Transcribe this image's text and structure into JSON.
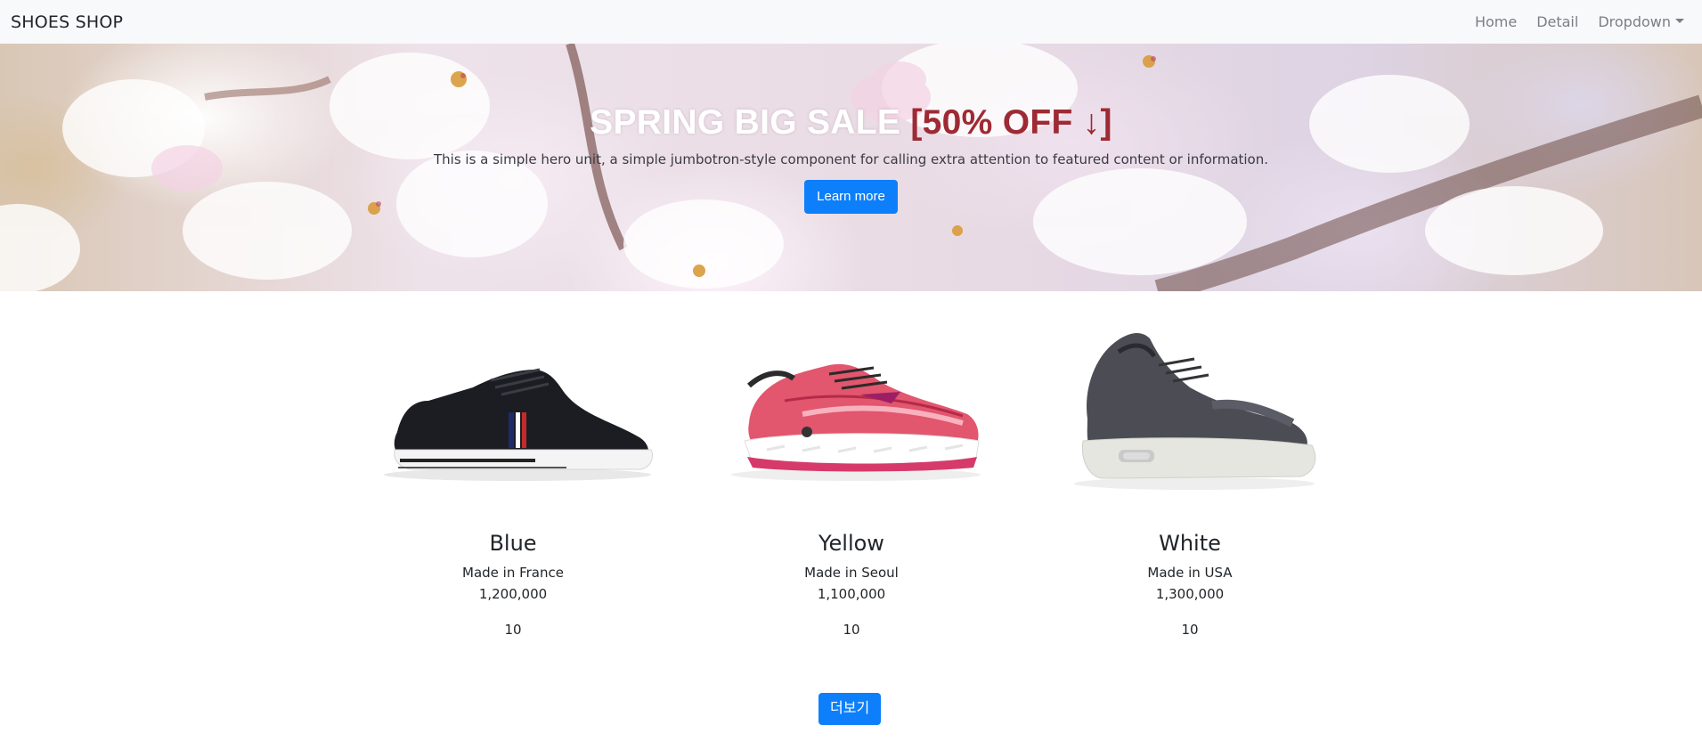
{
  "navbar": {
    "brand": "SHOES SHOP",
    "links": [
      "Home",
      "Detail",
      "Dropdown"
    ]
  },
  "jumbotron": {
    "title_main": "SPRING BIG SALE",
    "title_highlight": "[50% OFF ↓]",
    "description": "This is a simple hero unit, a simple jumbotron-style component for calling extra attention to featured content or information.",
    "button_label": "Learn more"
  },
  "products": [
    {
      "name": "Blue",
      "origin": "Made in France",
      "price": "1,200,000",
      "count": "10"
    },
    {
      "name": "Yellow",
      "origin": "Made in Seoul",
      "price": "1,100,000",
      "count": "10"
    },
    {
      "name": "White",
      "origin": "Made in USA",
      "price": "1,300,000",
      "count": "10"
    }
  ],
  "more_button_label": "더보기",
  "colors": {
    "navbar_bg": "#f8f9fa",
    "primary": "#0d7ffb",
    "highlight": "#9e2a33"
  }
}
